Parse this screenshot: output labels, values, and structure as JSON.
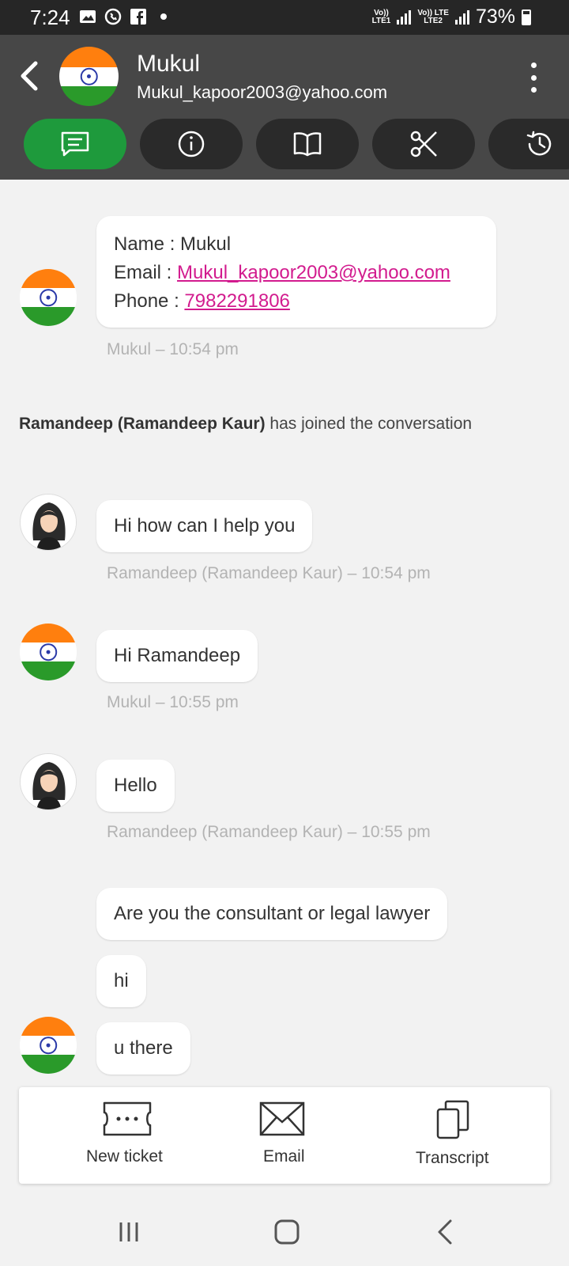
{
  "status_bar": {
    "time": "7:24",
    "battery": "73%",
    "net1_top": "Vo))",
    "net1_bottom": "LTE1",
    "net2_top": "Vo)) LTE",
    "net2_bottom": "LTE2"
  },
  "header": {
    "contact_name": "Mukul",
    "contact_email": "Mukul_kapoor2003@yahoo.com",
    "active_color": "#1e9a3c"
  },
  "tabs": [
    {
      "icon": "chat-icon",
      "active": true
    },
    {
      "icon": "info-icon",
      "active": false
    },
    {
      "icon": "book-icon",
      "active": false
    },
    {
      "icon": "scissors-icon",
      "active": false
    },
    {
      "icon": "history-icon",
      "active": false
    }
  ],
  "messages": {
    "info_card": {
      "name_label": "Name : ",
      "name_value": "Mukul",
      "email_label": "Email : ",
      "email_value": "Mukul_kapoor2003@yahoo.com",
      "phone_label": "Phone : ",
      "phone_value": "7982291806",
      "meta": "Mukul – 10:54 pm"
    },
    "system": {
      "agent": "Ramandeep (Ramandeep Kaur)",
      "text": " has joined the conversation"
    },
    "m1": {
      "text": "Hi how can I help you",
      "meta": "Ramandeep (Ramandeep Kaur) – 10:54 pm"
    },
    "m2": {
      "text": "Hi Ramandeep",
      "meta": "Mukul – 10:55 pm"
    },
    "m3": {
      "text": "Hello",
      "meta": "Ramandeep (Ramandeep Kaur) – 10:55 pm"
    },
    "m4": {
      "text": "Are you the consultant or legal lawyer"
    },
    "m5": {
      "text": "hi"
    },
    "m6": {
      "text": "u there"
    }
  },
  "actions": {
    "new_ticket": "New ticket",
    "email": "Email",
    "transcript": "Transcript"
  },
  "colors": {
    "link": "#d21b8e",
    "header_bg": "#474747",
    "saffron": "#ff7f0e",
    "green": "#2a9a2a"
  }
}
